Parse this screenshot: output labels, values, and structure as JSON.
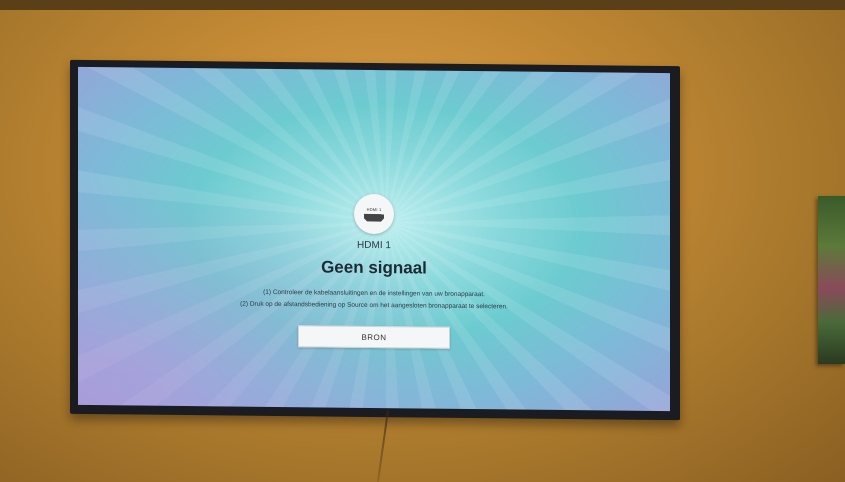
{
  "tv_screen": {
    "source_badge_label": "HDMI 1",
    "source_name": "HDMI 1",
    "title": "Geen signaal",
    "instructions": [
      "(1) Controleer de kabelaansluitingen en de instellingen van uw bronapparaat.",
      "(2) Druk op de afstandsbediening op Source om het aangesloten bronapparaat te selecteren."
    ],
    "button_label": "BRON"
  },
  "colors": {
    "wall": "#c48a35",
    "tv_frame": "#1a1c22",
    "screen_center": "#bfeff0",
    "screen_edge": "#9aa0d8",
    "button_bg": "#f5f6f7"
  },
  "icons": {
    "source": "hdmi-port-icon"
  }
}
